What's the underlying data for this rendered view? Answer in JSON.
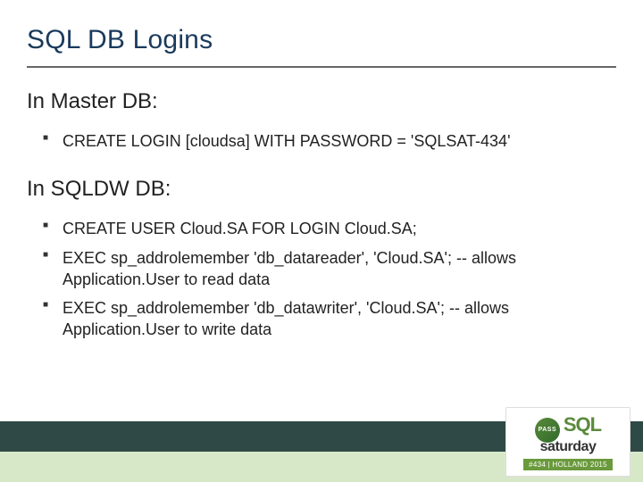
{
  "title": "SQL DB Logins",
  "sections": [
    {
      "heading": "In Master DB:",
      "items": [
        "CREATE LOGIN [cloudsa] WITH PASSWORD = 'SQLSAT-434'"
      ]
    },
    {
      "heading": "In SQLDW DB:",
      "items": [
        "CREATE USER Cloud.SA FOR LOGIN Cloud.SA;",
        "EXEC sp_addrolemember 'db_datareader', 'Cloud.SA'; -- allows Application.User to read data",
        "EXEC sp_addrolemember 'db_datawriter', 'Cloud.SA'; -- allows Application.User to write data"
      ]
    }
  ],
  "logo": {
    "pass": "PASS",
    "sql": "SQL",
    "saturday": "saturday",
    "tag": "#434 | HOLLAND 2015"
  }
}
